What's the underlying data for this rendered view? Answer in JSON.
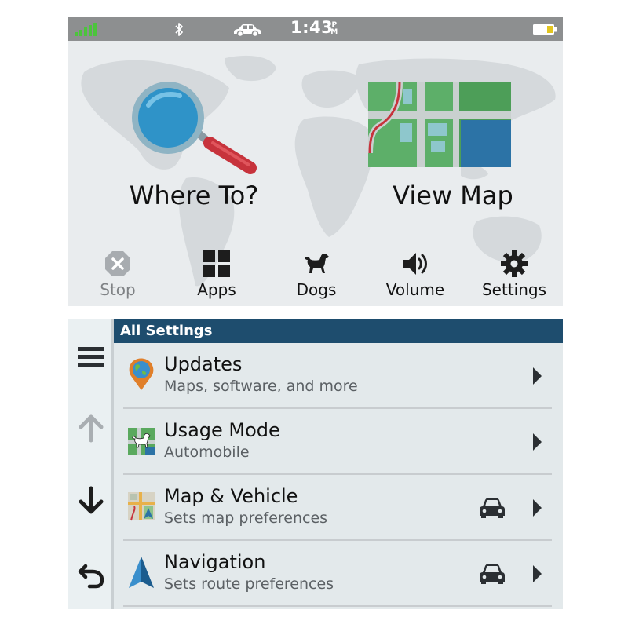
{
  "status_bar": {
    "time": "1:43",
    "ampm_top": "P",
    "ampm_bottom": "M",
    "icons": [
      "signal-bars-icon",
      "bluetooth-icon",
      "car-icon",
      "battery-icon"
    ]
  },
  "home": {
    "tiles": [
      {
        "label": "Where To?",
        "icon": "magnifier-icon"
      },
      {
        "label": "View Map",
        "icon": "map-icon"
      }
    ],
    "dock": [
      {
        "label": "Stop",
        "icon": "stop-icon"
      },
      {
        "label": "Apps",
        "icon": "apps-grid-icon"
      },
      {
        "label": "Dogs",
        "icon": "dog-icon"
      },
      {
        "label": "Volume",
        "icon": "speaker-icon"
      },
      {
        "label": "Settings",
        "icon": "gear-icon"
      }
    ]
  },
  "settings": {
    "header": "All Settings",
    "side_buttons": [
      "hamburger-menu-icon",
      "arrow-up-icon",
      "arrow-down-icon",
      "back-arrow-icon"
    ],
    "rows": [
      {
        "title": "Updates",
        "subtitle": "Maps, software, and more",
        "icon": "location-pin-globe-icon"
      },
      {
        "title": "Usage Mode",
        "subtitle": "Automobile",
        "icon": "usage-mode-dog-icon"
      },
      {
        "title": "Map & Vehicle",
        "subtitle": "Sets map preferences",
        "icon": "map-vehicle-icon"
      },
      {
        "title": "Navigation",
        "subtitle": "Sets route preferences",
        "icon": "navigation-arrow-icon"
      }
    ]
  },
  "colors": {
    "status_bar": "#8d8f90",
    "header": "#1e4d6e",
    "map_green": "#64b06f",
    "map_blue": "#2c73a6",
    "accent_red": "#c7333c"
  }
}
